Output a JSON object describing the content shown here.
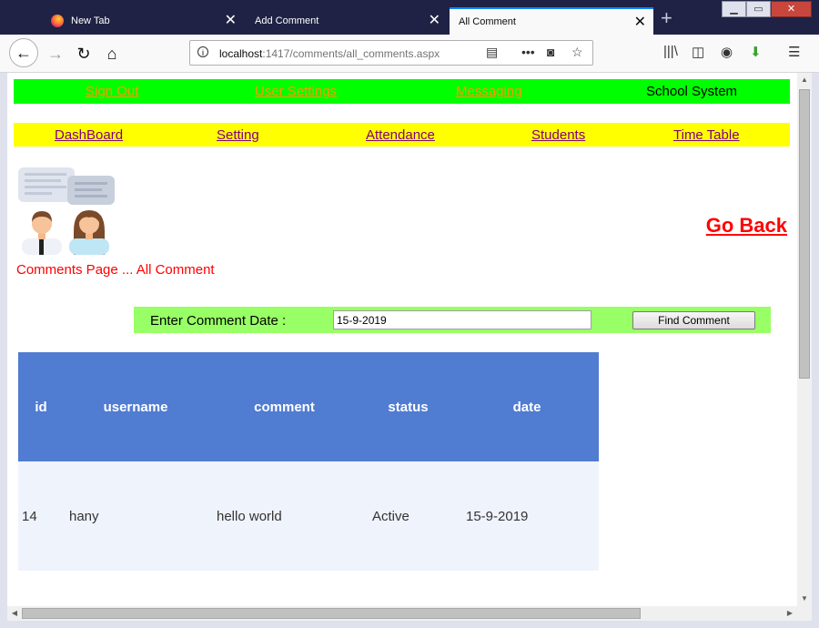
{
  "browser": {
    "tabs": [
      {
        "title": "New Tab",
        "active": false
      },
      {
        "title": "Add Comment",
        "active": false
      },
      {
        "title": "All Comment",
        "active": true
      }
    ],
    "url_host": "localhost",
    "url_path": ":1417/comments/all_comments.aspx",
    "icons": [
      "firefox-icon",
      "back-icon",
      "forward-icon",
      "reload-icon",
      "home-icon",
      "info-icon",
      "reader-view-icon",
      "more-icon",
      "pocket-icon",
      "bookmark-star-icon",
      "library-icon",
      "sidebar-icon",
      "account-icon",
      "download-icon",
      "menu-icon"
    ]
  },
  "topnav": {
    "sign_out": "Sign Out",
    "user_settings": "User Settings",
    "messaging": "Messaging",
    "brand": "School System",
    "bg_color": "#00ff00",
    "link_color": "#ff9900"
  },
  "mainnav": {
    "items": [
      "DashBoard",
      "Setting",
      "Attendance",
      "Students",
      "Time Table"
    ],
    "bg_color": "#ffff00",
    "link_color": "#800080"
  },
  "page": {
    "go_back": "Go Back",
    "title": "Comments Page ... All Comment",
    "accent": "#ff0000"
  },
  "search": {
    "label": "Enter Comment Date :",
    "value": "15-9-2019",
    "button": "Find Comment",
    "bg_color": "#99ff66"
  },
  "grid": {
    "headers": [
      "id",
      "username",
      "comment",
      "status",
      "date"
    ],
    "rows": [
      [
        "14",
        "hany",
        "hello world",
        "Active",
        "15-9-2019"
      ]
    ],
    "header_bg": "#507cd1",
    "row_bg": "#eff3fb"
  }
}
